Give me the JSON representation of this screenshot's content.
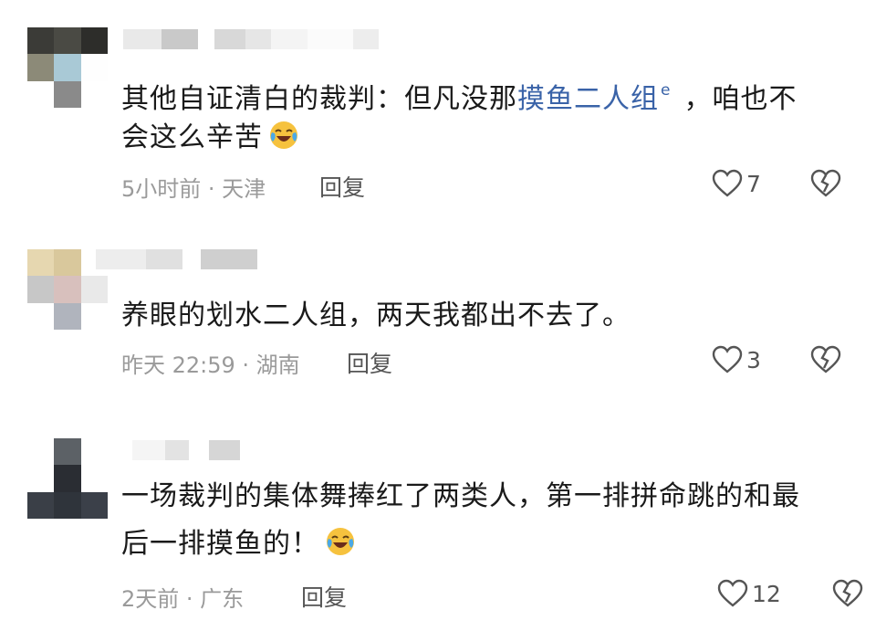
{
  "comments": [
    {
      "text_before_link": "其他自证清白的裁判：但凡没那",
      "link_text": "摸鱼二人组",
      "link_icon": "search-icon",
      "text_after_link": "，咱也不",
      "line2": "会这么辛苦",
      "emoji": "laughing-crying-emoji",
      "time_location": "5小时前 · 天津",
      "reply_label": "回复",
      "like_count": "7"
    },
    {
      "line1": "养眼的划水二人组，两天我都出不去了。",
      "time_location": "昨天 22:59 · 湖南",
      "reply_label": "回复",
      "like_count": "3"
    },
    {
      "line1": "一场裁判的集体舞捧红了两类人，第一排拼命跳的和最",
      "line2": "后一排摸鱼的！",
      "emoji": "laughing-crying-emoji",
      "time_location": "2天前 · 广东",
      "reply_label": "回复",
      "like_count": "12"
    }
  ],
  "colors": {
    "text": "#1a1a1a",
    "link": "#3a63a8",
    "meta": "#9a9a9a",
    "icon": "#555555"
  }
}
